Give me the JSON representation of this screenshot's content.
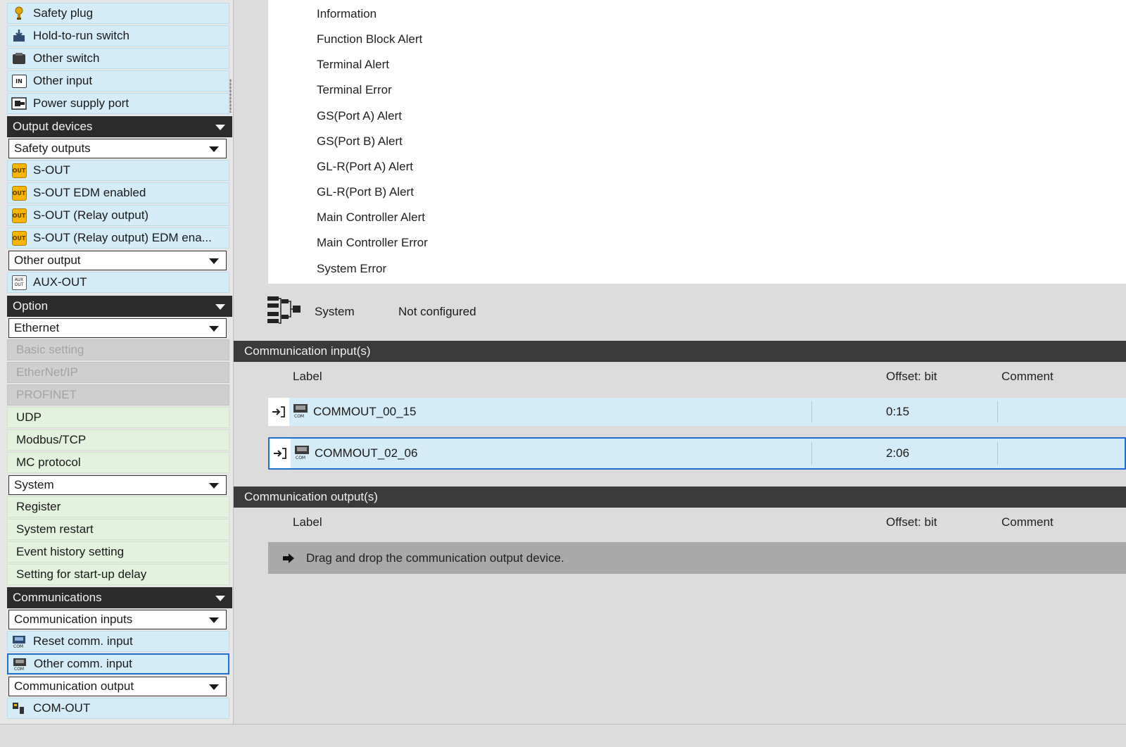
{
  "palette": {
    "input_items": [
      {
        "label": "Safety plug",
        "icon": "safety-plug-icon"
      },
      {
        "label": "Hold-to-run switch",
        "icon": "hold-to-run-icon"
      },
      {
        "label": "Other switch",
        "icon": "switch-icon"
      },
      {
        "label": "Other input",
        "icon": "in-badge-icon",
        "badge": "IN"
      },
      {
        "label": "Power supply port",
        "icon": "power-port-icon"
      }
    ],
    "output_devices": {
      "category": "Output devices",
      "safety_dropdown": "Safety outputs",
      "safety_items": [
        {
          "label": "S-OUT",
          "badge": "OUT"
        },
        {
          "label": "S-OUT EDM enabled",
          "badge": "OUT"
        },
        {
          "label": "S-OUT (Relay output)",
          "badge": "OUT"
        },
        {
          "label": "S-OUT (Relay output) EDM ena...",
          "badge": "OUT"
        }
      ],
      "other_dropdown": "Other output",
      "other_items": [
        {
          "label": "AUX-OUT",
          "badge_top": "AUX",
          "badge_bottom": "OUT"
        }
      ]
    },
    "option": {
      "category": "Option",
      "ethernet_dropdown": "Ethernet",
      "ethernet_disabled": [
        "Basic setting",
        "EtherNet/IP",
        "PROFINET"
      ],
      "ethernet_items": [
        "UDP",
        "Modbus/TCP",
        "MC protocol"
      ],
      "system_dropdown": "System",
      "system_items": [
        "Register",
        "System restart",
        "Event history setting",
        "Setting for start-up delay"
      ]
    },
    "communications": {
      "category": "Communications",
      "inputs_dropdown": "Communication inputs",
      "input_items": [
        "Reset comm. input",
        "Other comm. input"
      ],
      "output_dropdown": "Communication output",
      "output_items": [
        "COM-OUT"
      ]
    }
  },
  "main": {
    "alerts": [
      "Information",
      "Function Block Alert",
      "Terminal Alert",
      "Terminal Error",
      "GS(Port A) Alert",
      "GS(Port B) Alert",
      "GL-R(Port A) Alert",
      "GL-R(Port B) Alert",
      "Main Controller Alert",
      "Main Controller Error",
      "System Error"
    ],
    "system": {
      "label": "System",
      "status": "Not configured",
      "icon": "system-tree-icon"
    },
    "comm_inputs": {
      "title": "Communication input(s)",
      "columns": {
        "label": "Label",
        "offset": "Offset: bit",
        "comment": "Comment"
      },
      "rows": [
        {
          "label": "COMMOUT_00_15",
          "offset": "0:15",
          "comment": ""
        },
        {
          "label": "COMMOUT_02_06",
          "offset": "2:06",
          "comment": ""
        }
      ]
    },
    "comm_outputs": {
      "title": "Communication output(s)",
      "columns": {
        "label": "Label",
        "offset": "Offset: bit",
        "comment": "Comment"
      },
      "drop_hint": "Drag and drop the communication output device."
    }
  },
  "colors": {
    "accent_blue": "#1e6fd0",
    "item_blue": "#d4ecf8",
    "item_green": "#e3f2dd",
    "out_badge": "#f5b400",
    "header_dark": "#2b2b2b"
  }
}
